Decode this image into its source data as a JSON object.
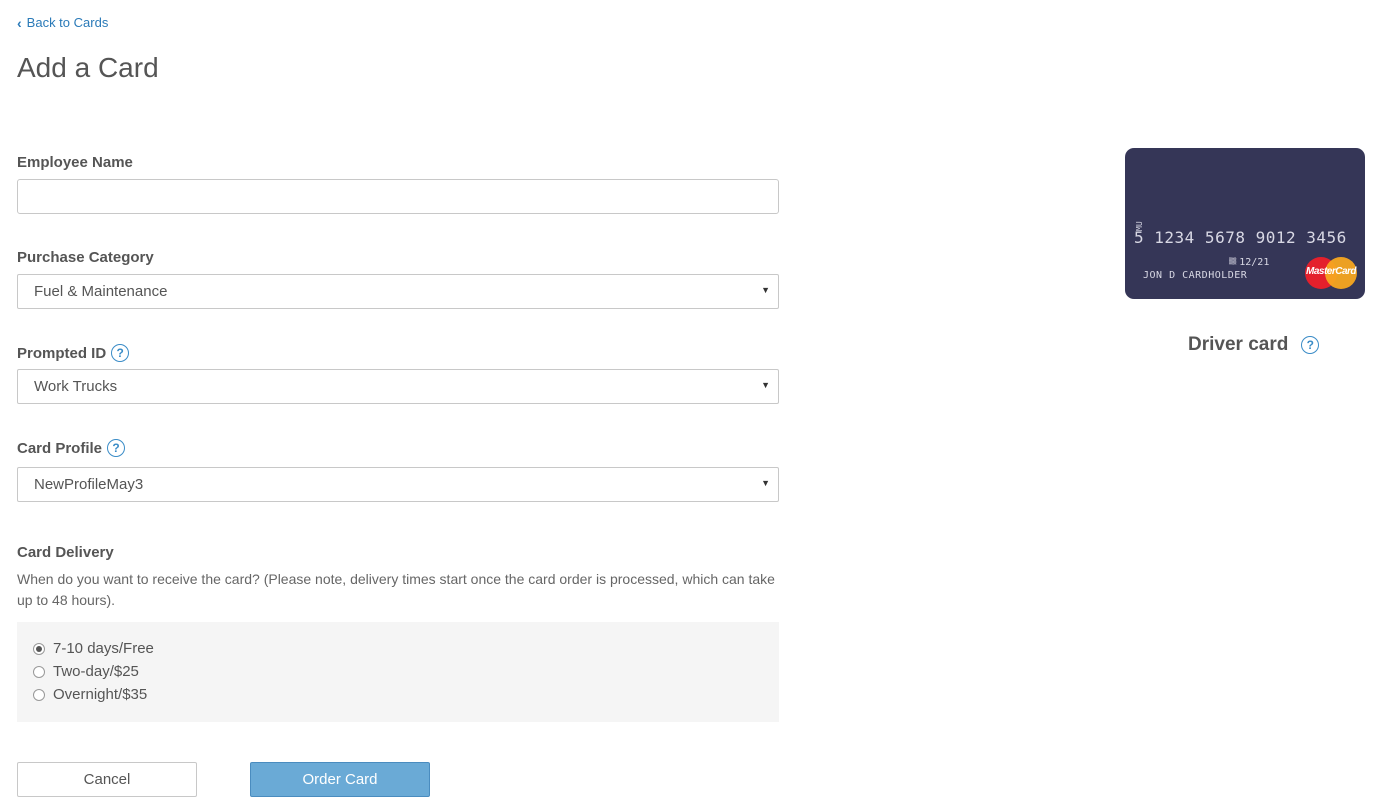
{
  "nav": {
    "back_label": "Back to Cards"
  },
  "page": {
    "title": "Add a Card"
  },
  "form": {
    "employee_name": {
      "label": "Employee Name",
      "value": ""
    },
    "purchase_category": {
      "label": "Purchase Category",
      "value": "Fuel & Maintenance"
    },
    "prompted_id": {
      "label": "Prompted ID",
      "value": "Work Trucks"
    },
    "card_profile": {
      "label": "Card Profile",
      "value": "NewProfileMay3"
    },
    "card_delivery": {
      "label": "Card Delivery",
      "description": "When do you want to receive the card? (Please note, delivery times start once the card order is processed, which can take up to 48 hours).",
      "options": [
        {
          "label": "7-10 days/Free",
          "selected": true
        },
        {
          "label": "Two-day/$25",
          "selected": false
        },
        {
          "label": "Overnight/$35",
          "selected": false
        }
      ]
    }
  },
  "buttons": {
    "cancel": "Cancel",
    "order": "Order Card"
  },
  "card_preview": {
    "number": "5 1234 5678 9012 3456",
    "mu": "MU",
    "expiry_prefix": "▒▒",
    "expiry": "12/21",
    "holder": "JON D CARDHOLDER",
    "brand": "MasterCard",
    "caption": "Driver card",
    "card_color": "#353657"
  },
  "icons": {
    "help": "?",
    "back": "‹"
  },
  "colors": {
    "link": "#2a7ab8",
    "primary_button": "#6aaad6",
    "help_icon": "#3a8cc7"
  }
}
